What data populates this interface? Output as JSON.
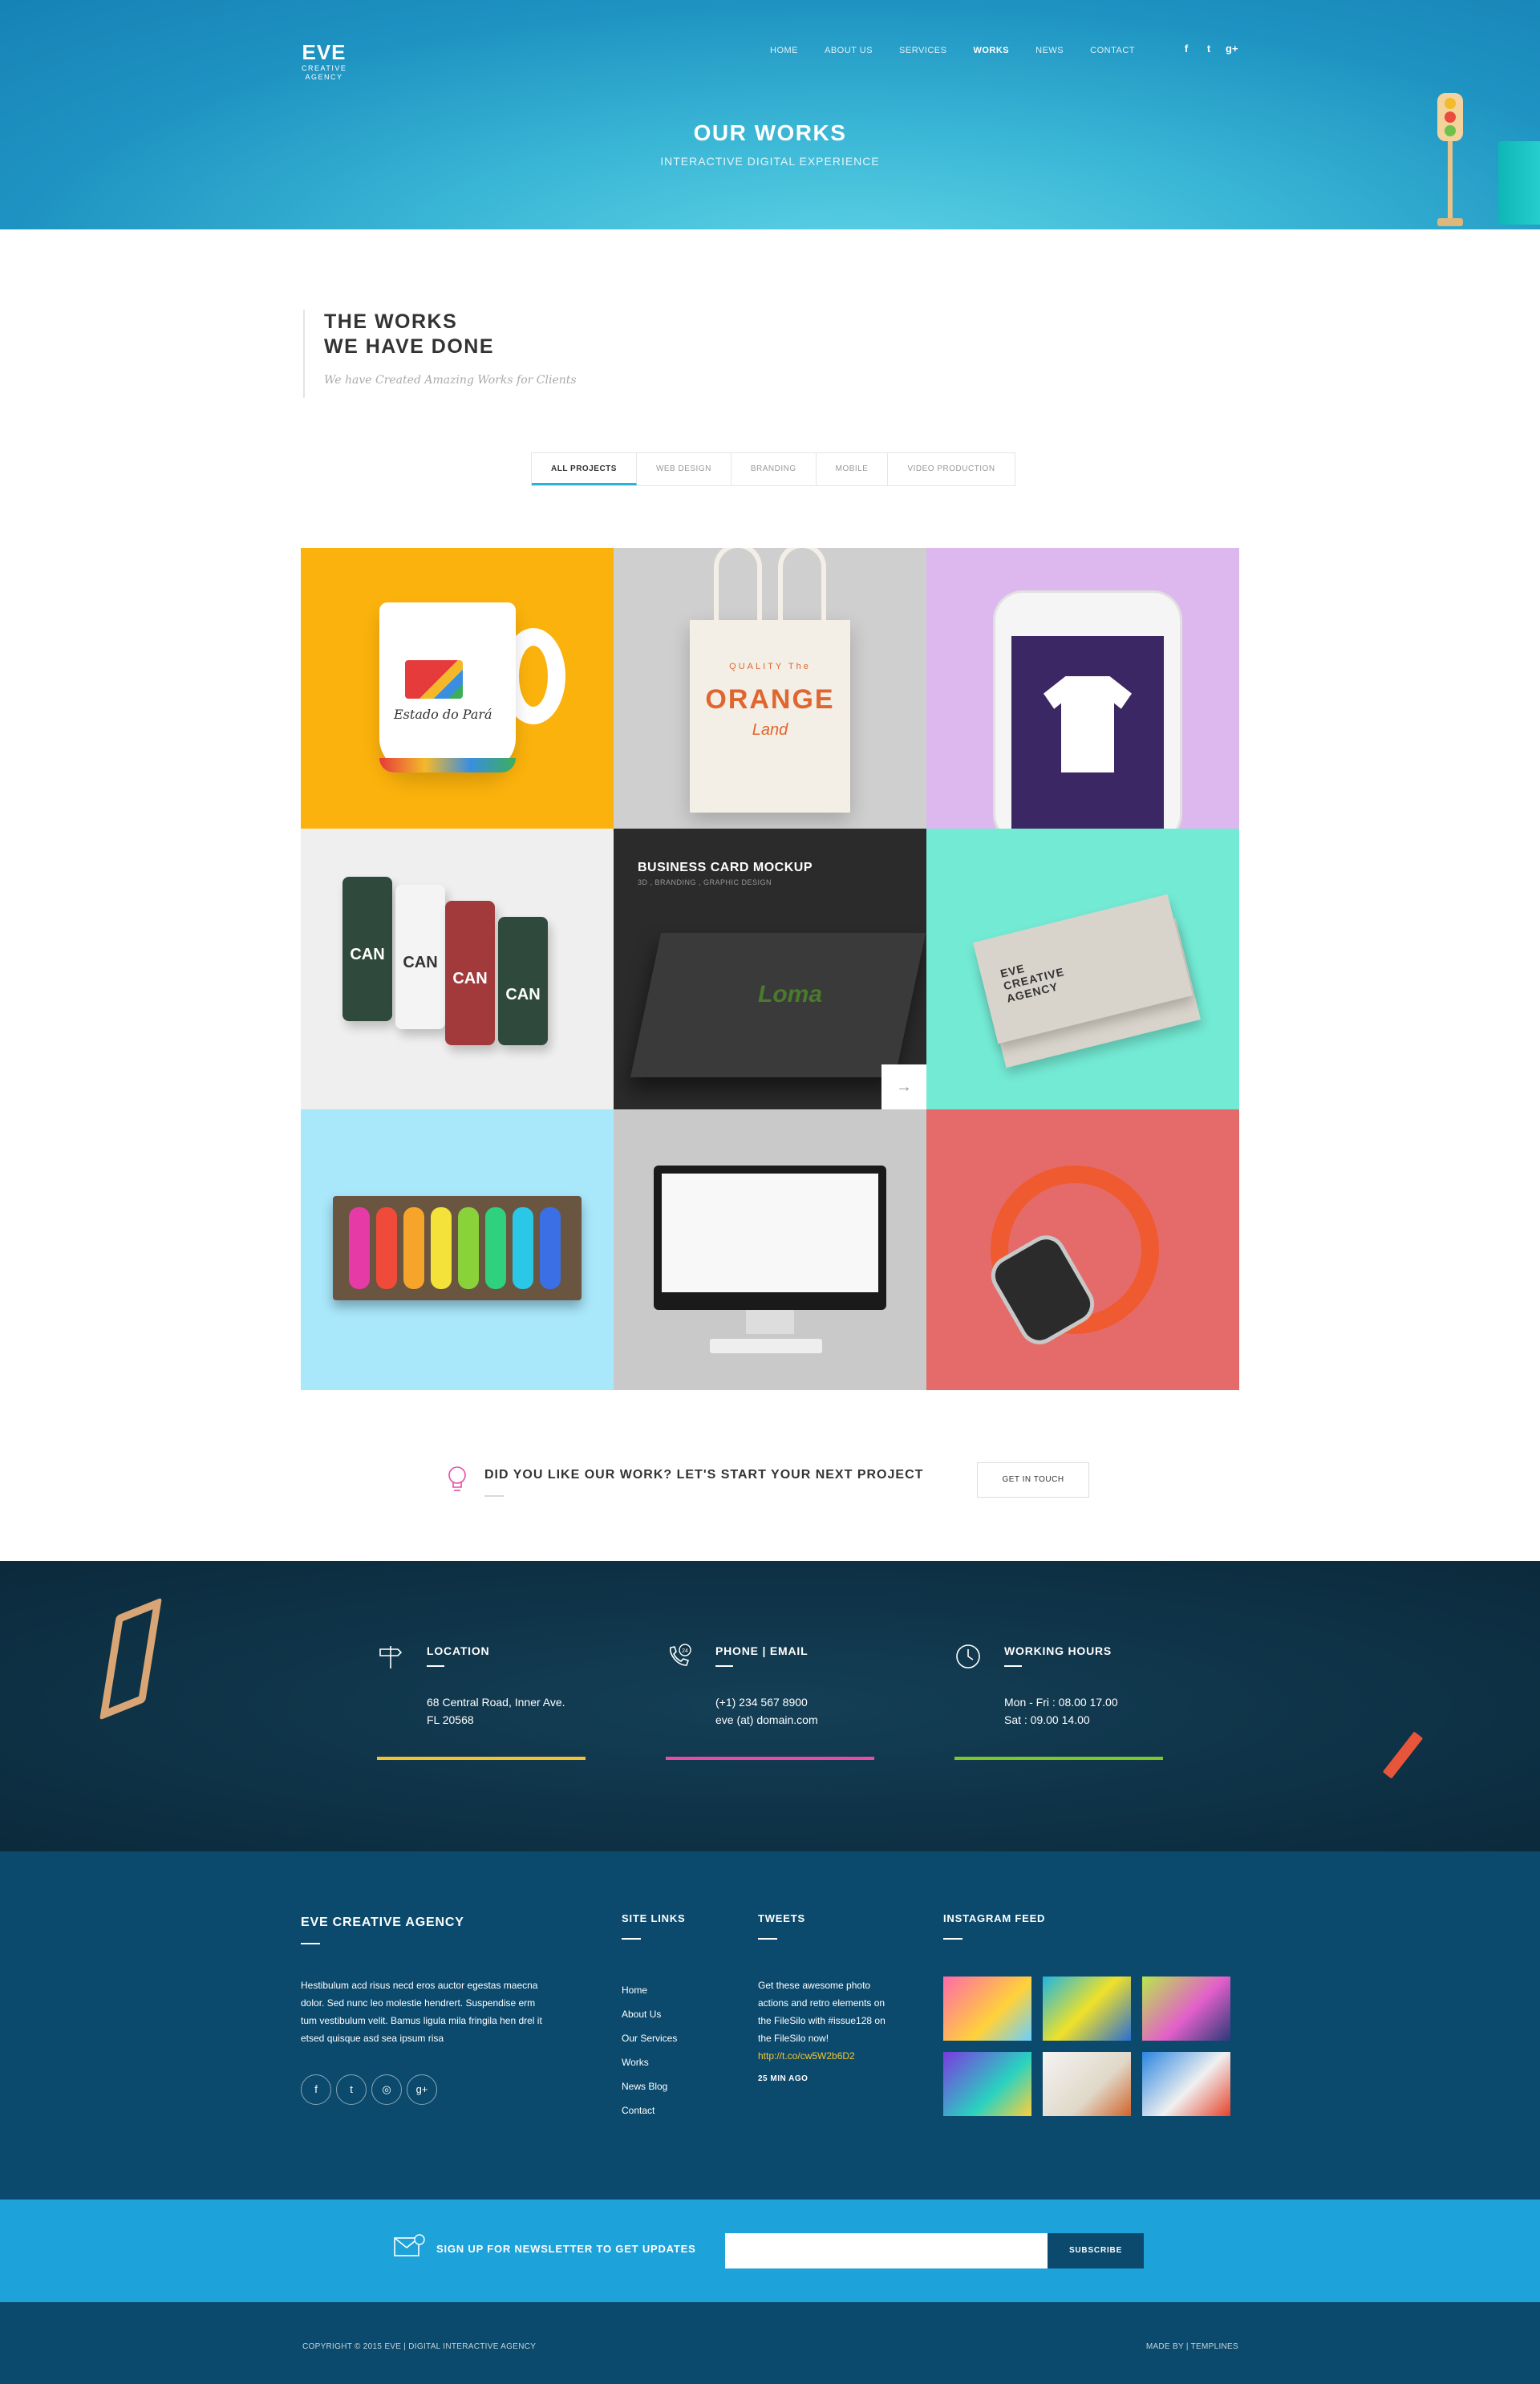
{
  "header": {
    "logo_mark": "EVE",
    "logo_sub1": "CREATIVE",
    "logo_sub2": "AGENCY",
    "nav": [
      "HOME",
      "ABOUT US",
      "SERVICES",
      "WORKS",
      "NEWS",
      "CONTACT"
    ],
    "active_nav": "WORKS",
    "social": {
      "facebook": "f",
      "twitter": "t",
      "google_plus": "g+"
    },
    "title": "OUR WORKS",
    "subtitle": "INTERACTIVE DIGITAL EXPERIENCE"
  },
  "section": {
    "title_line1": "THE WORKS",
    "title_line2": "WE HAVE DONE",
    "subtitle": "We have Created Amazing Works for Clients"
  },
  "filters": [
    "ALL PROJECTS",
    "WEB DESIGN",
    "BRANDING",
    "MOBILE",
    "VIDEO PRODUCTION"
  ],
  "portfolio": {
    "mug_text": "Estado do Pará",
    "tote_top": "QUALITY  The",
    "tote_main": "ORANGE",
    "tote_bottom": "Land",
    "can_label": "CAN",
    "featured_title": "BUSINESS CARD MOCKUP",
    "featured_tags": "3D , BRANDING , GRAPHIC DESIGN",
    "featured_logo": "Loma",
    "card_text_1": "EVE",
    "card_text_2": "CREATIVE",
    "card_text_3": "AGENCY"
  },
  "cta": {
    "text": "DID YOU LIKE OUR WORK? LET'S START YOUR NEXT PROJECT",
    "button": "GET IN TOUCH"
  },
  "contact": {
    "location": {
      "heading": "LOCATION",
      "line1": "68 Central Road, Inner Ave.",
      "line2": "FL 20568"
    },
    "phone": {
      "heading": "PHONE | EMAIL",
      "line1": "(+1) 234 567 8900",
      "line2": "eve (at) domain.com",
      "badge": "24"
    },
    "hours": {
      "heading": "WORKING HOURS",
      "line1": "Mon - Fri : 08.00 17.00",
      "line2": "Sat : 09.00  14.00"
    },
    "bar_colors": [
      "#f1c232",
      "#e94ba8",
      "#7cc72a"
    ]
  },
  "footer": {
    "agency_title": "EVE CREATIVE AGENCY",
    "agency_text": "Hestibulum acd risus necd eros auctor egestas maecna dolor. Sed nunc leo molestie hendrert. Suspendise erm tum vestibulum velit. Bamus ligula mila fringila hen drel it etsed quisque asd sea ipsum risa",
    "site_links_title": "SITE LINKS",
    "site_links": [
      "Home",
      "About Us",
      "Our Services",
      "Works",
      "News Blog",
      "Contact"
    ],
    "tweets_title": "TWEETS",
    "tweet_text": "Get these awesome photo actions and retro elements on the FileSilo with #issue128 on the FileSilo now!",
    "tweet_link": "http://t.co/cw5W2b6D2",
    "tweet_time": "25 MIN AGO",
    "instagram_title": "INSTAGRAM FEED"
  },
  "newsletter": {
    "text": "SIGN UP FOR NEWSLETTER TO GET UPDATES",
    "placeholder": "",
    "button": "SUBSCRIBE"
  },
  "bottom": {
    "copyright": "COPYRIGHT © 2015 EVE   |   DIGITAL INTERACTIVE AGENCY",
    "madeby": "MADE BY | TEMPLINES"
  },
  "colors": {
    "accent": "#2ab3d8",
    "footer": "#0c4a6d",
    "newsletter": "#1da2da",
    "tweet_link": "#f5c431"
  }
}
